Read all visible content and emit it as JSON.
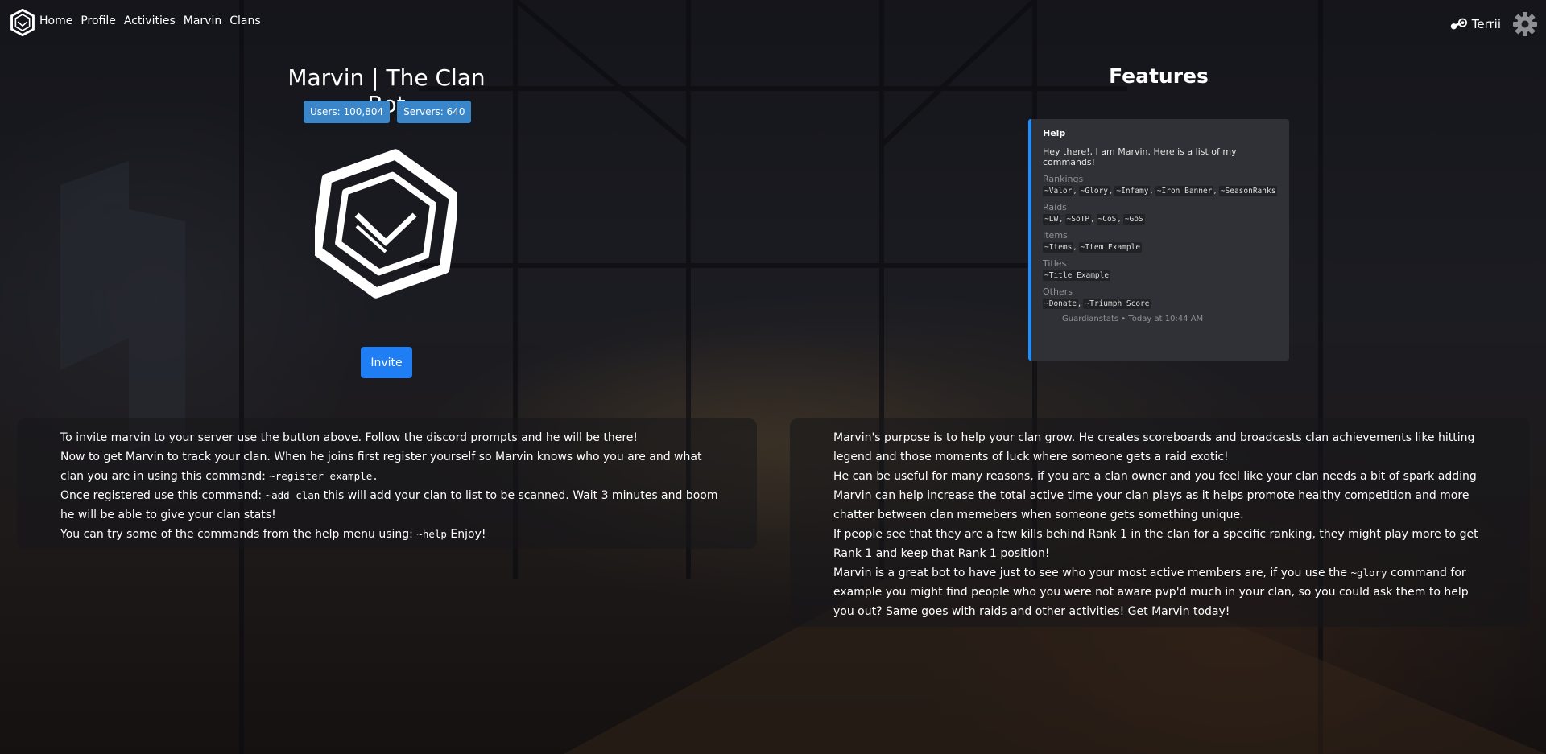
{
  "nav": {
    "links": [
      "Home",
      "Profile",
      "Activities",
      "Marvin",
      "Clans"
    ],
    "user": "Terrii"
  },
  "hero": {
    "title": "Marvin | The Clan Bot",
    "users_badge": "Users: 100,804",
    "servers_badge": "Servers: 640",
    "invite": "Invite"
  },
  "features": {
    "title": "Features",
    "embed": {
      "title": "Help",
      "description": "Hey there!, I am Marvin. Here is a list of my commands!",
      "fields": [
        {
          "name": "Rankings",
          "commands": [
            "~Valor",
            "~Glory",
            "~Infamy",
            "~Iron Banner",
            "~SeasonRanks"
          ]
        },
        {
          "name": "Raids",
          "commands": [
            "~LW",
            "~SoTP",
            "~CoS",
            "~GoS"
          ]
        },
        {
          "name": "Items",
          "commands": [
            "~Items",
            "~Item Example"
          ]
        },
        {
          "name": "Titles",
          "commands": [
            "~Title Example"
          ]
        },
        {
          "name": "Others",
          "commands": [
            "~Donate",
            "~Triumph Score"
          ]
        }
      ],
      "footer": "Guardianstats • Today at 10:44 AM"
    }
  },
  "left_panel": {
    "line1": "To invite marvin to your server use the button above. Follow the discord prompts and he will be there!",
    "line2a": "Now to get Marvin to track your clan. When he joins first register yourself so Marvin knows who you are and what clan you are in using this command: ",
    "line2_code": "~register example.",
    "line3a": "Once registered use this command: ",
    "line3_code": "~add clan",
    "line3b": " this will add your clan to list to be scanned. Wait 3 minutes and boom he will be able to give your clan stats!",
    "line4a": "You can try some of the commands from the help menu using: ",
    "line4_code": "~help",
    "line4b": " Enjoy!"
  },
  "right_panel": {
    "line1": "Marvin's purpose is to help your clan grow. He creates scoreboards and broadcasts clan achievements like hitting legend and those moments of luck where someone gets a raid exotic!",
    "line2": "He can be useful for many reasons, if you are a clan owner and you feel like your clan needs a bit of spark adding Marvin can help increase the total active time your clan plays as it helps promote healthy competition and more chatter between clan memebers when someone gets something unique.",
    "line3": "If people see that they are a few kills behind Rank 1 in the clan for a specific ranking, they might play more to get Rank 1 and keep that Rank 1 position!",
    "line4a": "Marvin is a great bot to have just to see who your most active members are, if you use the ",
    "line4_code": "~glory",
    "line4b": " command for example you might find people who you were not aware pvp'd much in your clan, so you could ask them to help you out? Same goes with raids and other activities! Get Marvin today!"
  },
  "colors": {
    "badge": "#3a86c8",
    "invite_button": "#1f7ef3",
    "embed_bg": "#2f3136",
    "embed_accent": "#1f8fff"
  }
}
